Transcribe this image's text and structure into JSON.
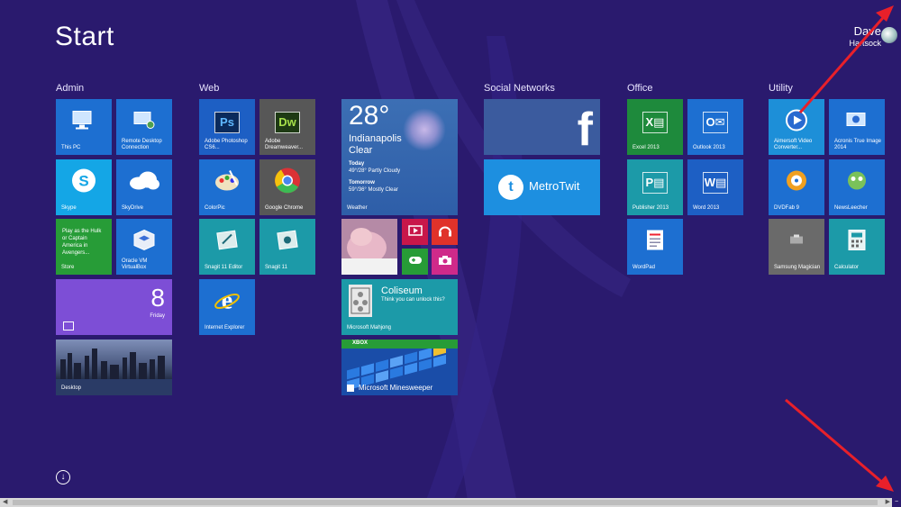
{
  "screen": {
    "title": "Start",
    "user": {
      "first": "Dave",
      "last": "Hartsock"
    },
    "apps_icon": "down-arrow-circle-icon"
  },
  "groups": {
    "admin": "Admin",
    "web": "Web",
    "social": "Social Networks",
    "office": "Office",
    "utility": "Utility"
  },
  "tiles": {
    "this_pc": "This PC",
    "remote_desktop": "Remote Desktop Connection",
    "skype": "Skype",
    "skydrive": "SkyDrive",
    "store": "Store",
    "store_text": "Play as the Hulk or Captain America in Avengers...",
    "virtualbox": "Oracle VM VirtualBox",
    "calendar_day": "8",
    "calendar_weekday": "Friday",
    "desktop": "Desktop",
    "photoshop": "Adobe Photoshop CS6...",
    "dreamweaver": "Adobe Dreamweaver...",
    "colorpic": "ColorPic",
    "chrome": "Google Chrome",
    "snagit_editor": "Snagit 11 Editor",
    "snagit": "Snagit 11",
    "ie": "Internet Explorer",
    "weather": {
      "temp": "28°",
      "city": "Indianapolis",
      "condition": "Clear",
      "today_label": "Today",
      "today": "49°/28° Partly Cloudy",
      "tomorrow_label": "Tomorrow",
      "tomorrow": "59°/36° Mostly Clear",
      "name": "Weather"
    },
    "coliseum_title": "Coliseum",
    "coliseum_sub": "Think you can unlock this?",
    "mahjong": "Microsoft Mahjong",
    "xbox_badge": "XBOX",
    "minesweeper": "Microsoft Minesweeper",
    "metrotwit": "MetroTwit",
    "excel": "Excel 2013",
    "outlook": "Outlook 2013",
    "publisher": "Publisher 2013",
    "word": "Word 2013",
    "wordpad": "WordPad",
    "aimersoft": "Aimersoft Video Converter...",
    "acronis": "Acronis True Image 2014",
    "dvdfab": "DVDFab 9",
    "newsleecher": "NewsLeecher",
    "samsung": "Samsung Magician",
    "calculator": "Calculator"
  },
  "colors": {
    "background": "#2a1a6e",
    "tile_blue": "#1d6fd1",
    "tile_dark": "#2b58c8",
    "tile_teal": "#1c9aa8",
    "tile_green": "#279c37",
    "tile_purple": "#7d4ed6",
    "arrow_red": "#e8202a"
  }
}
